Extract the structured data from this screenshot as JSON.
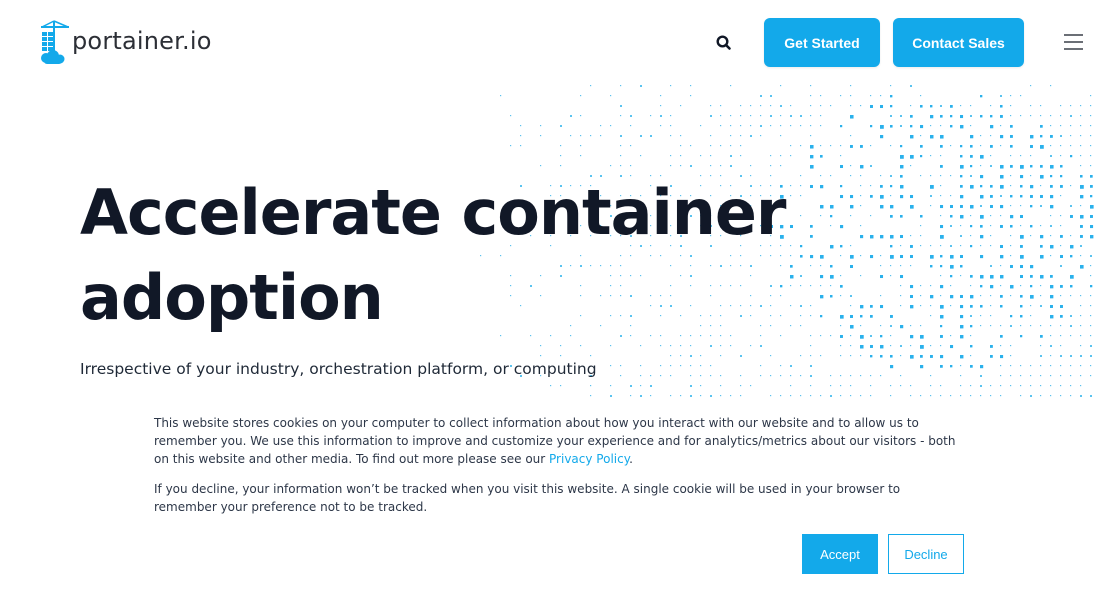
{
  "header": {
    "logo_text": "portainer.io",
    "get_started_label": "Get Started",
    "contact_sales_label": "Contact Sales"
  },
  "hero": {
    "title_line1": "Accelerate container",
    "title_line2": "adoption",
    "subtitle": "Irrespective of your industry, orchestration platform, or computing"
  },
  "cookie_banner": {
    "paragraph1_text": "This website stores cookies on your computer to collect information about how you interact with our website and to allow us to remember you. We use this information to improve and customize your experience and for analytics/metrics about our visitors - both on this website and other media. To find out more please see our ",
    "privacy_link": "Privacy Policy",
    "paragraph1_end": ".",
    "paragraph2_text": "If you decline, your information won’t be tracked when you visit this website. A single cookie will be used in your browser to remember your preference not to be tracked.",
    "accept_label": "Accept",
    "decline_label": "Decline"
  },
  "icons": {
    "search": "search-icon",
    "menu": "hamburger-menu-icon",
    "logo": "portainer-logo-icon"
  },
  "colors": {
    "brand": "#13a9ea",
    "heading": "#111827",
    "text": "#2d3748"
  }
}
